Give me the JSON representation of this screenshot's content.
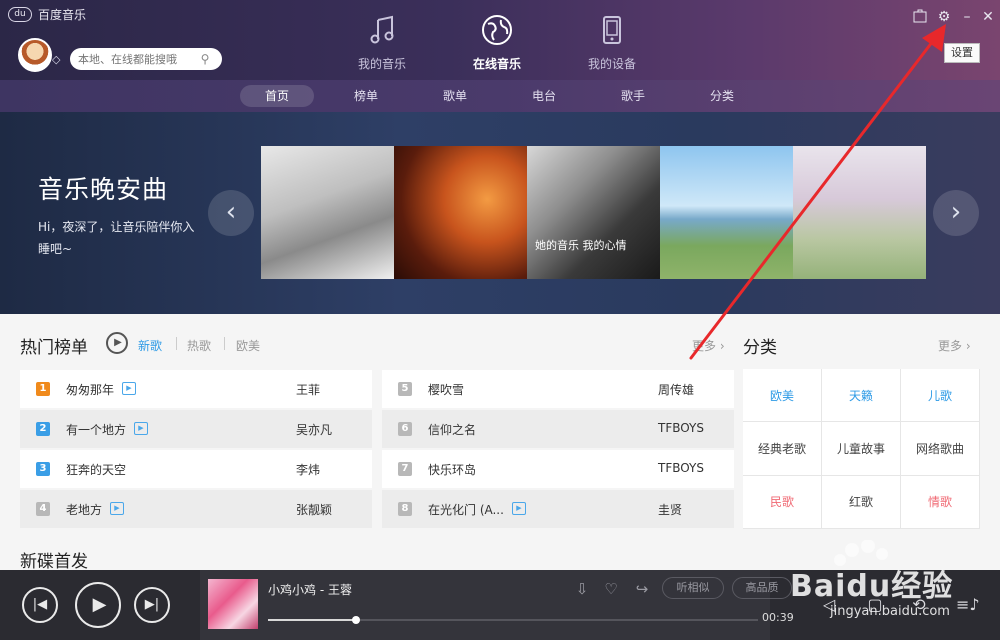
{
  "app": {
    "title": "百度音乐",
    "logo_text": "du"
  },
  "search": {
    "placeholder": "本地、在线都能搜哦"
  },
  "main_tabs": [
    {
      "label": "我的音乐",
      "icon": "music-note-icon",
      "active": false
    },
    {
      "label": "在线音乐",
      "icon": "globe-icon",
      "active": true
    },
    {
      "label": "我的设备",
      "icon": "phone-icon",
      "active": false
    }
  ],
  "window_controls": {
    "settings_tooltip": "设置"
  },
  "subnav": {
    "items": [
      {
        "label": "首页",
        "active": true
      },
      {
        "label": "榜单",
        "active": false
      },
      {
        "label": "歌单",
        "active": false
      },
      {
        "label": "电台",
        "active": false
      },
      {
        "label": "歌手",
        "active": false
      },
      {
        "label": "分类",
        "active": false
      }
    ]
  },
  "banner": {
    "title": "音乐晚安曲",
    "subtitle": "Hi，夜深了，让音乐陪伴你入睡吧~",
    "photo_caption": "她的音乐 我的心情"
  },
  "hot_chart": {
    "title": "热门榜单",
    "filters": [
      {
        "label": "新歌",
        "active": true
      },
      {
        "label": "热歌",
        "active": false
      },
      {
        "label": "欧美",
        "active": false
      }
    ],
    "more_label": "更多",
    "songs_left": [
      {
        "rank": "1",
        "name": "匆匆那年",
        "artist": "王菲",
        "mv": true
      },
      {
        "rank": "2",
        "name": "有一个地方",
        "artist": "吴亦凡",
        "mv": true
      },
      {
        "rank": "3",
        "name": "狂奔的天空",
        "artist": "李炜",
        "mv": false
      },
      {
        "rank": "4",
        "name": "老地方",
        "artist": "张靓颖",
        "mv": true
      }
    ],
    "songs_right": [
      {
        "rank": "5",
        "name": "樱吹雪",
        "artist": "周传雄",
        "mv": false
      },
      {
        "rank": "6",
        "name": "信仰之名",
        "artist": "TFBOYS",
        "mv": false
      },
      {
        "rank": "7",
        "name": "快乐环岛",
        "artist": "TFBOYS",
        "mv": false
      },
      {
        "rank": "8",
        "name": "在光化门 (A...",
        "artist": "圭贤",
        "mv": true
      }
    ]
  },
  "category": {
    "title": "分类",
    "more_label": "更多",
    "items": [
      {
        "label": "欧美",
        "color": "#2e9be6"
      },
      {
        "label": "天籁",
        "color": "#2e9be6"
      },
      {
        "label": "儿歌",
        "color": "#2e9be6"
      },
      {
        "label": "经典老歌",
        "color": "#444444"
      },
      {
        "label": "儿童故事",
        "color": "#444444"
      },
      {
        "label": "网络歌曲",
        "color": "#444444"
      },
      {
        "label": "民歌",
        "color": "#f06a74"
      },
      {
        "label": "红歌",
        "color": "#444444"
      },
      {
        "label": "情歌",
        "color": "#f06a74"
      }
    ]
  },
  "new_album": {
    "title": "新碟首发"
  },
  "player": {
    "track_title": "小鸡小鸡 - 王蓉",
    "time": "00:39",
    "progress": 0.18,
    "similar_label": "听相似",
    "quality_label": "高品质"
  },
  "watermark": {
    "text": "Baidu经验",
    "url": "jingyan.baidu.com"
  },
  "colors": {
    "accent": "#2e9be6",
    "rank_top": "#f08a1c",
    "rank_mid": "#3a9ee6",
    "annotation": "#e8282b"
  }
}
